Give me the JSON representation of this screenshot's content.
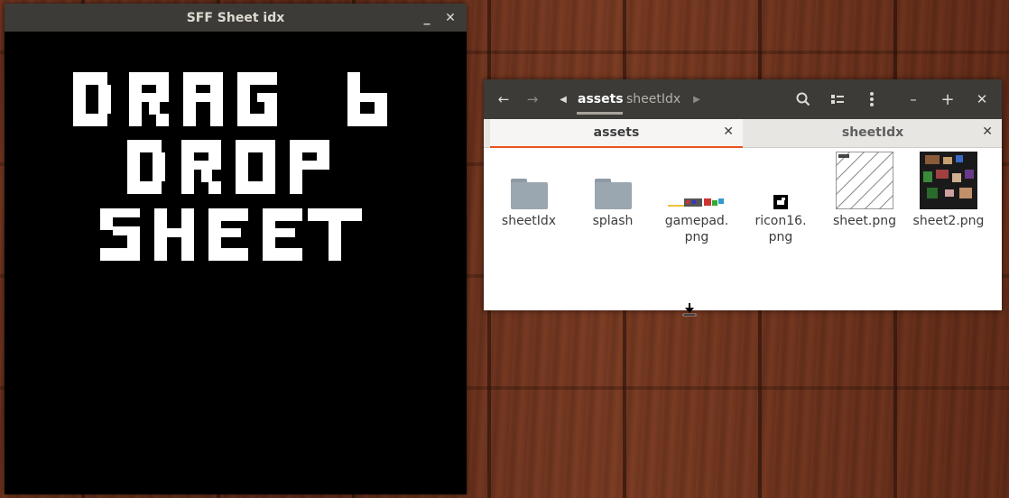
{
  "left_window": {
    "title": "SFF Sheet idx",
    "minimize_glyph": "_",
    "close_glyph": "✕",
    "canvas_text_lines": [
      "DRAG &",
      "DROP",
      "SHEET"
    ]
  },
  "file_manager": {
    "nav": {
      "back_glyph": "←",
      "forward_glyph": "→",
      "prev_glyph": "◀",
      "next_glyph": "▶"
    },
    "breadcrumbs": [
      "assets",
      "sheetIdx"
    ],
    "header_icons": {
      "search": "🔍",
      "view": "☷",
      "menu": "⋮",
      "minimize": "–",
      "maximize": "+",
      "close": "✕"
    },
    "tabs": [
      {
        "label": "assets",
        "active": true
      },
      {
        "label": "sheetIdx",
        "active": false
      }
    ],
    "tab_close_glyph": "✕",
    "items": [
      {
        "label": "sheetIdx",
        "kind": "folder"
      },
      {
        "label": "splash",
        "kind": "folder"
      },
      {
        "label": "gamepad.\npng",
        "kind": "image-gamepad"
      },
      {
        "label": "ricon16.\npng",
        "kind": "image-icon"
      },
      {
        "label": "sheet.png",
        "kind": "image-sheet"
      },
      {
        "label": "sheet2.png",
        "kind": "image-sheet2"
      }
    ]
  },
  "colors": {
    "accent": "#e95420",
    "titlebar": "#3c3b37",
    "folder": "#9aa6b0"
  }
}
